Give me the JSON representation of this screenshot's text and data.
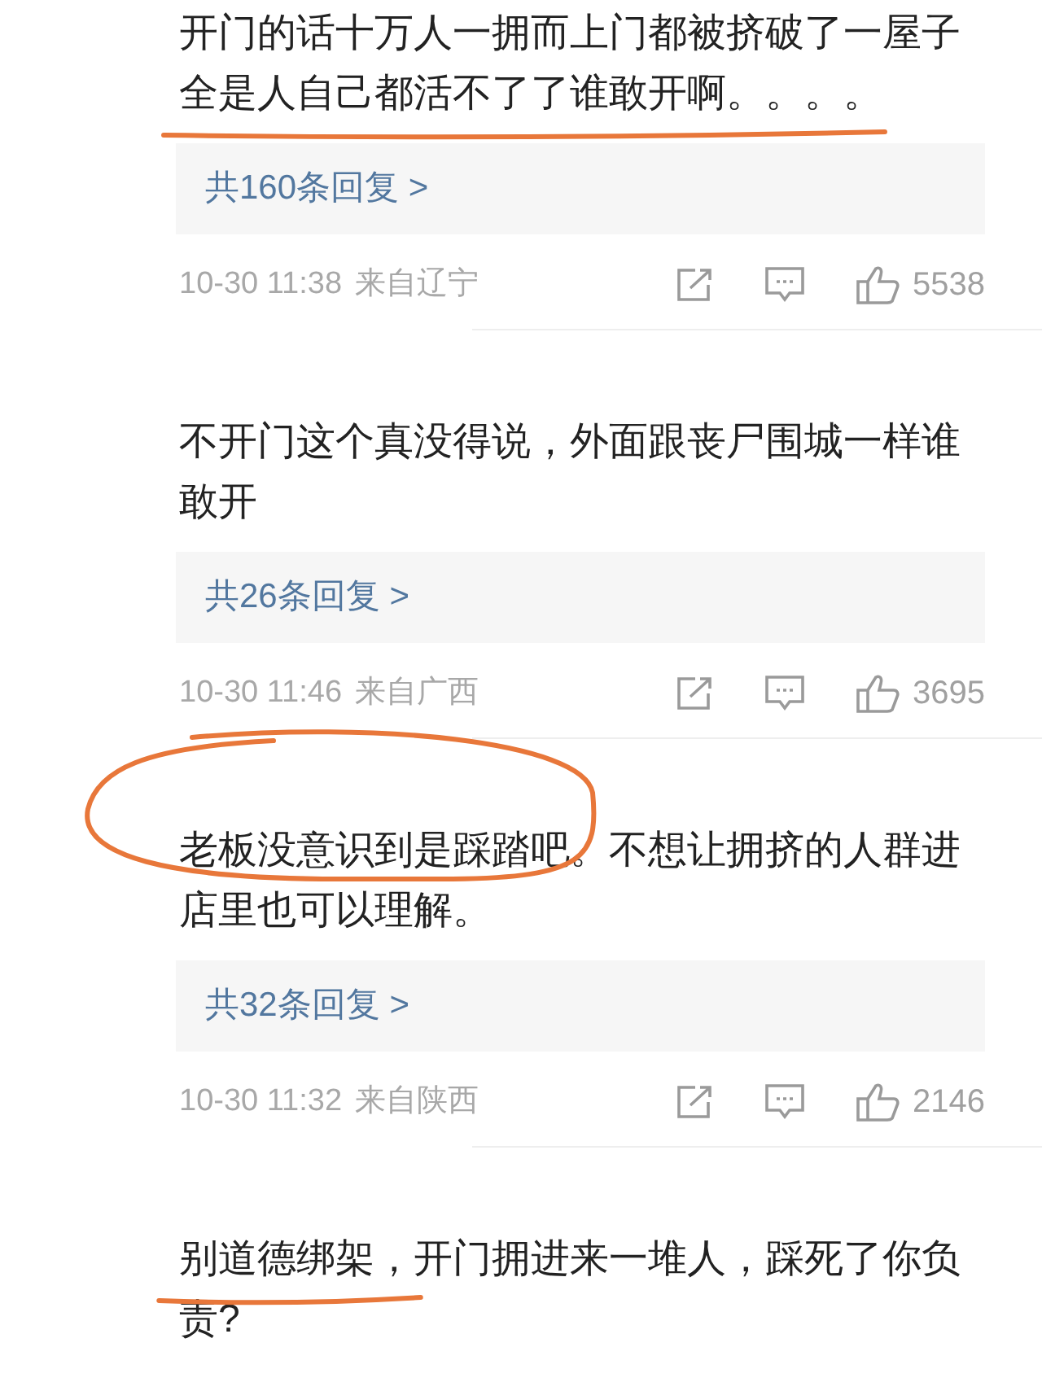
{
  "comments": [
    {
      "parts": [
        {
          "text": "开门的话十万人一拥而上门都被挤破了一屋子",
          "underlined": false,
          "circled": false
        },
        {
          "text": "全是人自己都活不了了谁敢开啊。。。。",
          "underlined": true,
          "circled": false
        }
      ],
      "replies": "共160条回复 >",
      "time": "10-30 11:38",
      "location": "来自辽宁",
      "likes": "5538"
    },
    {
      "parts": [
        {
          "text": "不开门这个真没得说，外面跟丧尸围城一样谁敢开",
          "underlined": false,
          "circled": false
        }
      ],
      "replies": "共26条回复 >",
      "time": "10-30 11:46",
      "location": "来自广西",
      "likes": "3695"
    },
    {
      "parts": [
        {
          "text": "老板没意识到是踩踏吧",
          "underlined": false,
          "circled": true
        },
        {
          "text": "。不想让拥挤的人群进店里也可以理解。",
          "underlined": false,
          "circled": false
        }
      ],
      "replies": "共32条回复 >",
      "time": "10-30 11:32",
      "location": "来自陕西",
      "likes": "2146"
    },
    {
      "parts": [
        {
          "text": "别道德绑架，",
          "underlined": true,
          "circled": false
        },
        {
          "text": "开门拥进来一堆人，踩死了你负责?",
          "underlined": false,
          "circled": false
        }
      ]
    }
  ]
}
